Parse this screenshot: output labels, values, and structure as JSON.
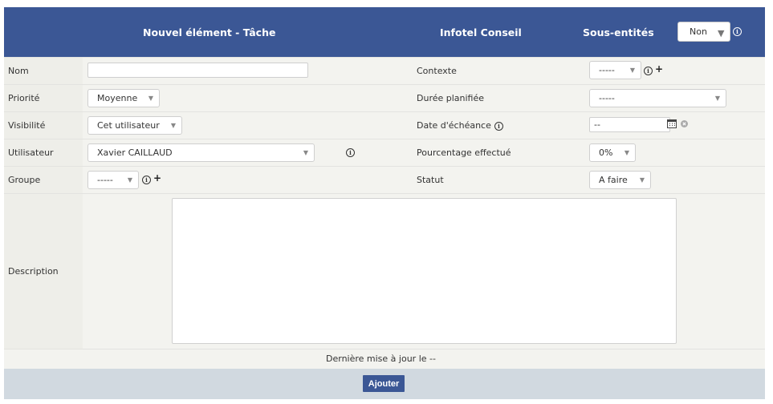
{
  "header": {
    "title": "Nouvel élément - Tâche",
    "entity": "Infotel Conseil",
    "subentities_label": "Sous-entités",
    "subentities_value": "Non"
  },
  "fields": {
    "nom": {
      "label": "Nom",
      "value": ""
    },
    "priorite": {
      "label": "Priorité",
      "value": "Moyenne"
    },
    "visibilite": {
      "label": "Visibilité",
      "value": "Cet utilisateur"
    },
    "utilisateur": {
      "label": "Utilisateur",
      "value": "Xavier CAILLAUD"
    },
    "groupe": {
      "label": "Groupe",
      "value": "-----"
    },
    "description": {
      "label": "Description",
      "value": ""
    },
    "contexte": {
      "label": "Contexte",
      "value": "-----"
    },
    "duree": {
      "label": "Durée planifiée",
      "value": "-----"
    },
    "echeance": {
      "label": "Date d'échéance",
      "value": "--"
    },
    "pourcentage": {
      "label": "Pourcentage effectué",
      "value": "0%"
    },
    "statut": {
      "label": "Statut",
      "value": "A faire"
    }
  },
  "last_update": "Dernière mise à jour le --",
  "actions": {
    "add": "Ajouter"
  },
  "colors": {
    "header_bg": "#3b5795",
    "form_bg": "#f3f3ef",
    "footer_bg": "#d1d9e0",
    "button_bg": "#3b5795"
  }
}
